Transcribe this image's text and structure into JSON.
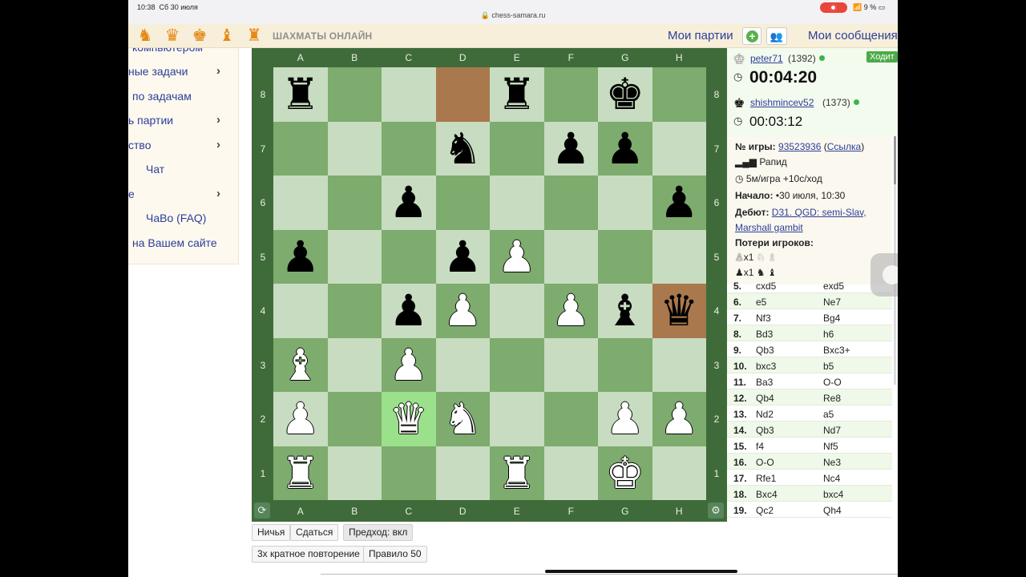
{
  "status_bar": {
    "time": "10:38",
    "date": "Сб 30 июля",
    "url": "chess-samara.ru",
    "battery": "9 %"
  },
  "top_nav": {
    "icons": [
      "knight-icon",
      "queen-icon",
      "king-icon",
      "bishop-icon",
      "rook-icon"
    ],
    "site_title": "ШАХМАТЫ ОНЛАЙН",
    "my_games": "Мои партии",
    "my_messages": "Мои сообщения"
  },
  "left_menu": [
    {
      "label": "компьютером",
      "chevron": false
    },
    {
      "label": "ные задачи",
      "chevron": true
    },
    {
      "label": "по задачам",
      "chevron": false
    },
    {
      "label": "ь партии",
      "chevron": true
    },
    {
      "label": "ство",
      "chevron": true
    },
    {
      "label": "Чат",
      "chevron": false
    },
    {
      "label": "е",
      "chevron": true
    },
    {
      "label": "ЧаВо (FAQ)",
      "chevron": false
    },
    {
      "label": "на Вашем сайте",
      "chevron": false
    }
  ],
  "board": {
    "files": [
      "A",
      "B",
      "C",
      "D",
      "E",
      "F",
      "G",
      "H"
    ],
    "ranks": [
      "8",
      "7",
      "6",
      "5",
      "4",
      "3",
      "2",
      "1"
    ],
    "highlights": [
      {
        "square": "d8",
        "color": "brown"
      },
      {
        "square": "h4",
        "color": "brown"
      },
      {
        "square": "c2",
        "color": "green"
      }
    ],
    "pieces": [
      {
        "sq": "a8",
        "p": "r"
      },
      {
        "sq": "e8",
        "p": "r"
      },
      {
        "sq": "g8",
        "p": "k"
      },
      {
        "sq": "d7",
        "p": "n"
      },
      {
        "sq": "f7",
        "p": "p"
      },
      {
        "sq": "g7",
        "p": "p"
      },
      {
        "sq": "c6",
        "p": "p"
      },
      {
        "sq": "h6",
        "p": "p"
      },
      {
        "sq": "a5",
        "p": "p"
      },
      {
        "sq": "d5",
        "p": "p"
      },
      {
        "sq": "e5",
        "p": "P"
      },
      {
        "sq": "c4",
        "p": "p"
      },
      {
        "sq": "d4",
        "p": "P"
      },
      {
        "sq": "f4",
        "p": "P"
      },
      {
        "sq": "g4",
        "p": "b"
      },
      {
        "sq": "h4",
        "p": "q"
      },
      {
        "sq": "a3",
        "p": "B"
      },
      {
        "sq": "c3",
        "p": "P"
      },
      {
        "sq": "a2",
        "p": "P"
      },
      {
        "sq": "c2",
        "p": "Q"
      },
      {
        "sq": "d2",
        "p": "N"
      },
      {
        "sq": "g2",
        "p": "P"
      },
      {
        "sq": "h2",
        "p": "P"
      },
      {
        "sq": "a1",
        "p": "R"
      },
      {
        "sq": "e1",
        "p": "R"
      },
      {
        "sq": "g1",
        "p": "K"
      }
    ]
  },
  "buttons": {
    "draw": "Ничья",
    "resign": "Сдаться",
    "premove": "Предход: вкл",
    "threefold": "3х кратное повторение",
    "rule50": "Правило 50"
  },
  "players": {
    "top": {
      "name": "peter71",
      "rating": "(1392)",
      "clock": "00:04:20",
      "turn_badge": "Ходит"
    },
    "bottom": {
      "name": "shishmincev52",
      "rating": "(1373)",
      "clock": "00:03:12"
    }
  },
  "game_info": {
    "game_no_label": "№ игры:",
    "game_no": "93523936",
    "link_label": "Ссылка",
    "type": "Рапид",
    "time_control": "5м/игра +10с/ход",
    "start_label": "Начало:",
    "start_value": "•30 июля, 10:30",
    "debut_label": "Дебют:",
    "debut_line1": "D31. QGD: semi-Slav,",
    "debut_line2": "Marshall gambit",
    "losses_label": "Потери игроков:",
    "white_losses": "x1",
    "black_losses": "x1"
  },
  "moves": [
    {
      "n": "5.",
      "w": "cxd5",
      "b": "exd5"
    },
    {
      "n": "6.",
      "w": "e5",
      "b": "Ne7"
    },
    {
      "n": "7.",
      "w": "Nf3",
      "b": "Bg4"
    },
    {
      "n": "8.",
      "w": "Bd3",
      "b": "h6"
    },
    {
      "n": "9.",
      "w": "Qb3",
      "b": "Bxc3+"
    },
    {
      "n": "10.",
      "w": "bxc3",
      "b": "b5"
    },
    {
      "n": "11.",
      "w": "Ba3",
      "b": "O-O"
    },
    {
      "n": "12.",
      "w": "Qb4",
      "b": "Re8"
    },
    {
      "n": "13.",
      "w": "Nd2",
      "b": "a5"
    },
    {
      "n": "14.",
      "w": "Qb3",
      "b": "Nd7"
    },
    {
      "n": "15.",
      "w": "f4",
      "b": "Nf5"
    },
    {
      "n": "16.",
      "w": "O-O",
      "b": "Ne3"
    },
    {
      "n": "17.",
      "w": "Rfe1",
      "b": "Nc4"
    },
    {
      "n": "18.",
      "w": "Bxc4",
      "b": "bxc4"
    },
    {
      "n": "19.",
      "w": "Qc2",
      "b": "Qh4"
    }
  ]
}
